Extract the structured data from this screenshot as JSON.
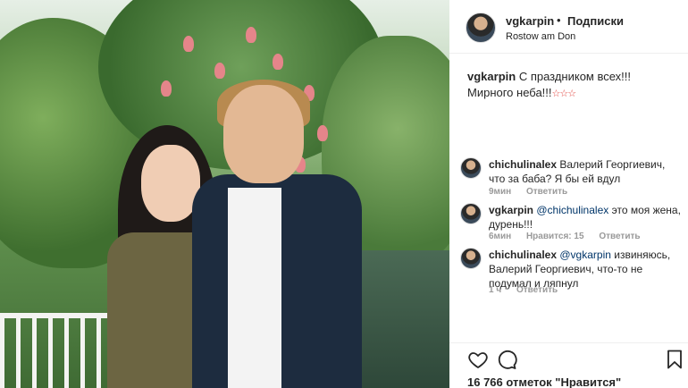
{
  "header": {
    "username": "vgkarpin",
    "separator": "•",
    "follow_label": "Подписки",
    "location": "Rostow am Don"
  },
  "caption": {
    "username": "vgkarpin",
    "text": "С праздником всех!!! Мирного неба!!!",
    "emoji": "☆☆☆"
  },
  "comments": [
    {
      "username": "chichulinalex",
      "text": "Валерий Георгиевич, что за баба? Я бы ей вдул",
      "time": "9мин",
      "reply_label": "Ответить"
    },
    {
      "username": "vgkarpin",
      "mention": "@chichulinalex",
      "text": "это моя жена, дурень!!!",
      "time": "6мин",
      "likes": "Нравится: 15",
      "reply_label": "Ответить"
    },
    {
      "username": "chichulinalex",
      "mention": "@vgkarpin",
      "text": "извиняюсь, Валерий Георгиевич, что-то не подумал и ляпнул",
      "time": "1 ч",
      "reply_label": "Ответить"
    }
  ],
  "footer": {
    "likes_text": "16 766 отметок \"Нравится\"",
    "icons": [
      "heart-icon",
      "comment-icon",
      "bookmark-icon"
    ]
  },
  "colors": {
    "text": "#262626",
    "meta": "#999999",
    "mention": "#003569",
    "divider": "#efefef",
    "emoji": "#e0413b"
  }
}
